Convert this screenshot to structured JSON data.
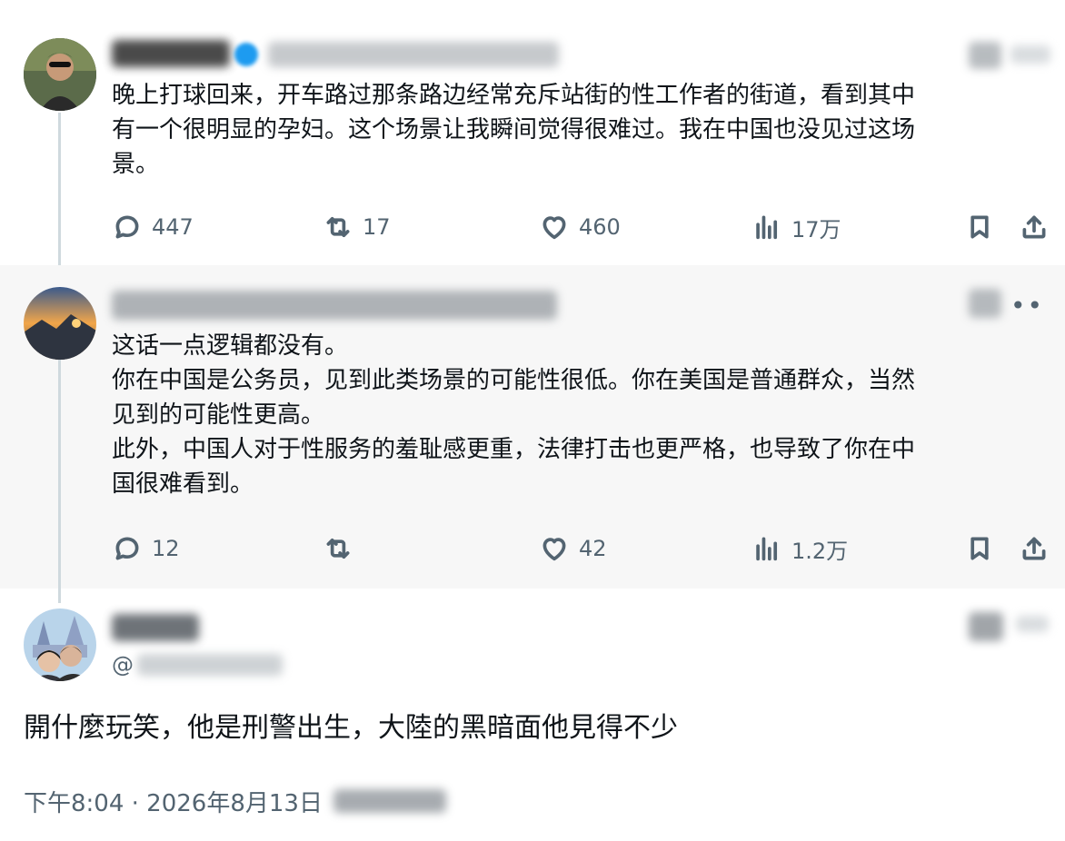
{
  "posts": [
    {
      "id": "alex",
      "text": "晚上打球回来，开车路过那条路边经常充斥站街的性工作者的街道，看到其中\n有一个很明显的孕妇。这个场景让我瞬间觉得很难过。我在中国也没见过这场\n景。",
      "stats": {
        "replies": "447",
        "reposts": "17",
        "likes": "460",
        "views": "17万"
      }
    },
    {
      "id": "reply",
      "text": "这话一点逻辑都没有。\n你在中国是公务员，见到此类场景的可能性很低。你在美国是普通群众，当然\n见到的可能性更高。\n此外，中国人对于性服务的羞耻感更重，法律打击也更严格，也导致了你在中\n国很难看到。",
      "stats": {
        "replies": "12",
        "reposts": "",
        "likes": "42",
        "views": "1.2万"
      }
    }
  ],
  "main_post": {
    "handle_prefix": "@",
    "text": "開什麼玩笑，他是刑警出生，大陸的黑暗面他見得不少",
    "timestamp": "下午8:04 · 2026年8月13日"
  },
  "icons": [
    "reply-icon",
    "repost-icon",
    "like-icon",
    "views-icon",
    "bookmark-icon",
    "share-icon",
    "more-icon",
    "grok-icon"
  ],
  "colors": {
    "text": "#0f1419",
    "secondary": "#536471",
    "highlight_bg": "#f7f7f7",
    "thread_line": "#cfd9de",
    "verified": "#1d9bf0"
  }
}
